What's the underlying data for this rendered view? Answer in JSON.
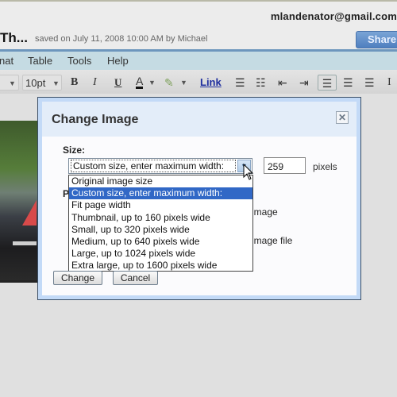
{
  "header": {
    "user_email": "mlandenator@gmail.com",
    "doc_title": "Th...",
    "save_status": "saved on July 11, 2008 10:00 AM by Michael",
    "share_label": "Share"
  },
  "menubar": {
    "items": [
      "nat",
      "Table",
      "Tools",
      "Help"
    ]
  },
  "toolbar": {
    "font_size": "10pt",
    "bold": "B",
    "italic": "I",
    "underline": "U",
    "text_color": "A",
    "link": "Link",
    "icons": [
      "font-dropdown-arrow",
      "bold-icon",
      "italic-icon",
      "underline-icon",
      "text-color-icon",
      "highlight-icon",
      "link",
      "numbered-list-icon",
      "bulleted-list-icon",
      "decrease-indent-icon",
      "increase-indent-icon",
      "align-left-icon",
      "align-center-icon",
      "align-right-icon"
    ]
  },
  "dialog": {
    "title": "Change Image",
    "close_glyph": "✕",
    "size_label": "Size:",
    "position_label_partial": "P",
    "selected_size": "Custom size, enter maximum width:",
    "width_value": "259",
    "pixels_label": "pixels",
    "hidden_option_1_partial": "image",
    "hidden_option_2_partial": "image file",
    "size_options": [
      "Original image size",
      "Custom size, enter maximum width:",
      "Fit page width",
      "Thumbnail, up to 160 pixels wide",
      "Small, up to 320 pixels wide",
      "Medium, up to 640 pixels wide",
      "Large, up to 1024 pixels wide",
      "Extra large, up to 1600 pixels wide"
    ],
    "selected_index": 1,
    "change_label": "Change",
    "cancel_label": "Cancel"
  },
  "colors": {
    "menubar_bg": "#c5dbe3",
    "menubar_accent": "#6d96bd",
    "share_blue": "#5a88c6",
    "dialog_frame": "#c3daf7",
    "selected_option": "#3168c6",
    "link_color": "#1f2f9f"
  }
}
